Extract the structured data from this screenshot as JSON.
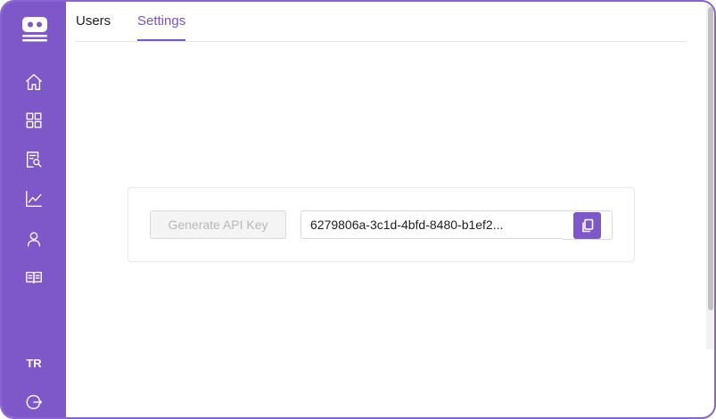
{
  "sidebar": {
    "logo": "robot-logo",
    "items": [
      {
        "icon": "home-icon"
      },
      {
        "icon": "grid-icon"
      },
      {
        "icon": "document-search-icon"
      },
      {
        "icon": "chart-line-icon"
      },
      {
        "icon": "user-icon"
      },
      {
        "icon": "book-icon"
      }
    ],
    "initials": "TR",
    "logout_icon": "logout-icon"
  },
  "tabs": [
    {
      "label": "Users",
      "active": false
    },
    {
      "label": "Settings",
      "active": true
    }
  ],
  "settings": {
    "generate_button_label": "Generate API Key",
    "generate_button_disabled": true,
    "api_key_value": "6279806a-3c1d-4bfd-8480-b1ef2...",
    "copy_icon": "copy-icon"
  },
  "colors": {
    "accent": "#7e57c8",
    "sidebar": "#7e57c8"
  }
}
